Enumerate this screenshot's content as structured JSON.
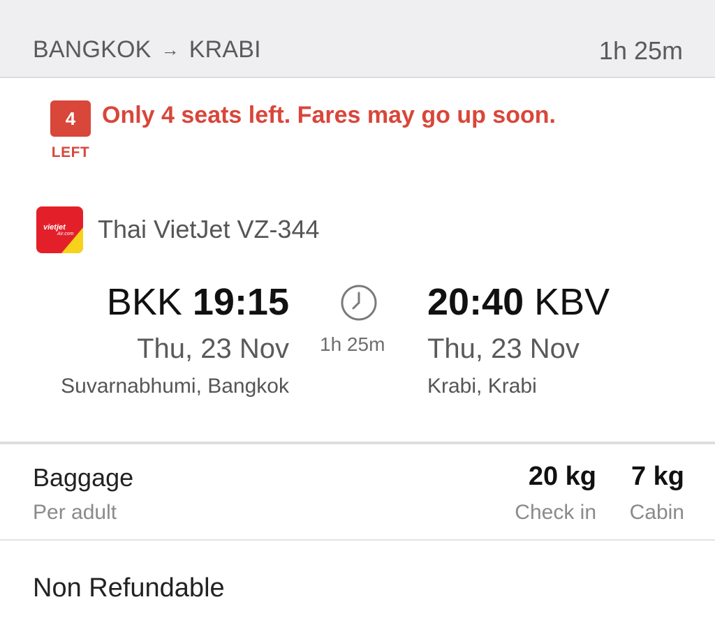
{
  "header": {
    "origin": "BANGKOK",
    "arrow": "→",
    "destination": "KRABI",
    "duration": "1h 25m"
  },
  "availability": {
    "seats_count": "4",
    "seats_label": "LEFT",
    "message": "Only 4 seats left. Fares may go up soon.",
    "accent_color": "#d9463a"
  },
  "airline": {
    "logo_icon": "vietjet-logo-icon",
    "logo_text_top": "vietjet",
    "logo_text_bottom": "Air.com",
    "name": "Thai VietJet VZ-344"
  },
  "departure": {
    "code": "BKK",
    "time": "19:15",
    "date": "Thu, 23 Nov",
    "airport": "Suvarnabhumi, Bangkok"
  },
  "arrival": {
    "code": "KBV",
    "time": "20:40",
    "date": "Thu, 23 Nov",
    "airport": "Krabi, Krabi"
  },
  "flight": {
    "duration_icon": "clock-icon",
    "duration": "1h 25m"
  },
  "baggage": {
    "title": "Baggage",
    "subtitle": "Per adult",
    "checkin_value": "20 kg",
    "checkin_label": "Check in",
    "cabin_value": "7 kg",
    "cabin_label": "Cabin"
  },
  "policy": {
    "refund": "Non Refundable"
  }
}
